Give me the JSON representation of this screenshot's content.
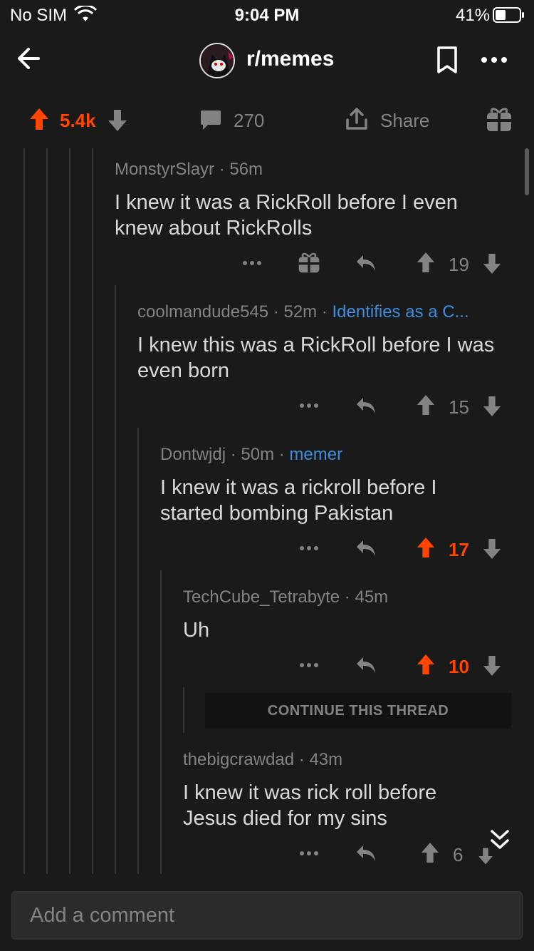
{
  "status_bar": {
    "carrier": "No SIM",
    "time": "9:04 PM",
    "battery": "41%"
  },
  "header": {
    "subreddit": "r/memes"
  },
  "post_actions": {
    "score": "5.4k",
    "comments": "270",
    "share_label": "Share"
  },
  "comments": [
    {
      "author": "MonstyrSlayr",
      "age": "56m",
      "flair": "",
      "line1": "I knew it was a RickRoll before I even",
      "line2": "knew about RickRolls",
      "score": "19",
      "upvoted": false
    },
    {
      "author": "coolmandude545",
      "age": "52m",
      "flair": "Identifies as a C...",
      "line1": "I knew this was a RickRoll before I was",
      "line2": "even born",
      "score": "15",
      "upvoted": false
    },
    {
      "author": "Dontwjdj",
      "age": "50m",
      "flair": "memer",
      "line1": "I knew it was a rickroll before I",
      "line2": "started bombing Pakistan",
      "score": "17",
      "upvoted": true
    },
    {
      "author": "TechCube_Tetrabyte",
      "age": "45m",
      "flair": "",
      "line1": "Uh",
      "line2": "",
      "score": "10",
      "upvoted": true
    },
    {
      "author": "thebigcrawdad",
      "age": "43m",
      "flair": "",
      "line1": "I knew it was rick roll before",
      "line2": "Jesus died for my sins",
      "score": "6",
      "upvoted": false
    }
  ],
  "continue_thread": "CONTINUE THIS THREAD",
  "composer": {
    "placeholder": "Add a comment"
  },
  "colors": {
    "background": "#1a1a1b",
    "upvote": "#ff4500",
    "flair": "#3c8ddb",
    "muted": "#818384",
    "text": "#d7dadc"
  }
}
